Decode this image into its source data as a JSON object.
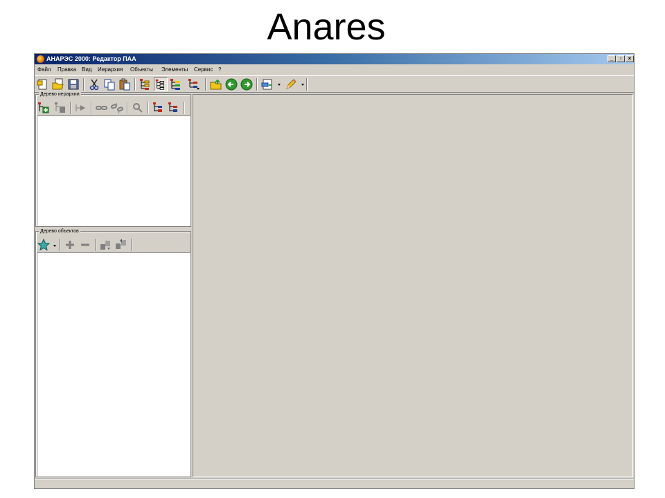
{
  "slide": {
    "title": "Anares"
  },
  "window": {
    "title": "АНАРЭС 2000: Редактор ПАА",
    "minimize_glyph": "_",
    "maximize_glyph": "▫",
    "close_glyph": "×"
  },
  "menu": {
    "items": [
      {
        "label": "Файл"
      },
      {
        "label": "Правка"
      },
      {
        "label": "Вид"
      },
      {
        "label": "Иерархия"
      },
      {
        "label": "Объекты"
      },
      {
        "label": "Элементы"
      },
      {
        "label": "Сервис"
      },
      {
        "label": "?"
      }
    ]
  },
  "toolbar": {
    "icons": [
      "new-document-icon",
      "open-folder-icon",
      "save-icon",
      "cut-icon",
      "copy-icon",
      "paste-icon",
      "tree-view-icon",
      "tree-view-selected-icon",
      "tree-expand-icon",
      "tree-collapse-icon",
      "folder-up-icon",
      "back-arrow-icon",
      "forward-arrow-icon",
      "print-preview-icon",
      "pencil-icon"
    ]
  },
  "panels": {
    "hierarchy_tree": {
      "label": "Дерево иерархии"
    },
    "object_tree": {
      "label": "Дерево объектов"
    }
  },
  "colors": {
    "titlebar_start": "#0a246a",
    "titlebar_end": "#a6caf0",
    "face": "#d4d0c8",
    "accent_green": "#2f9a2f",
    "accent_red": "#c0281f",
    "accent_yellow": "#f0c419",
    "accent_blue": "#1f3f9a"
  }
}
